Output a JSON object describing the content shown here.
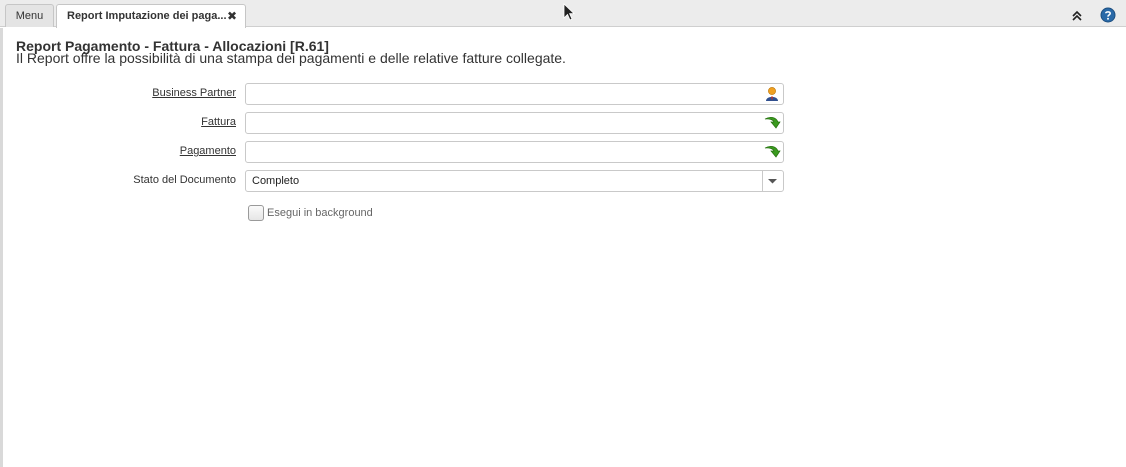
{
  "tabs": {
    "menu_label": "Menu",
    "active_label": "Report Imputazione dei paga...",
    "close_glyph": "✖"
  },
  "toolbar": {
    "collapse_icon": "double-chevron-up-icon",
    "help_icon": "help-icon"
  },
  "report": {
    "title": "Report Pagamento - Fattura - Allocazioni [R.61]",
    "description": "Il Report offre la possibilità di una stampa dei pagamenti e delle relative fatture collegate."
  },
  "form": {
    "business_partner": {
      "label": "Business Partner",
      "value": "",
      "icon": "person-icon"
    },
    "fattura": {
      "label": "Fattura",
      "value": "",
      "icon": "green-arrow-icon"
    },
    "pagamento": {
      "label": "Pagamento",
      "value": "",
      "icon": "green-arrow-icon"
    },
    "stato_documento": {
      "label": "Stato del Documento",
      "value": "Completo"
    },
    "background": {
      "label": "Esegui in background",
      "checked": false
    }
  },
  "colors": {
    "accent_green": "#3a9a1e",
    "help_blue": "#2a6aa8"
  }
}
